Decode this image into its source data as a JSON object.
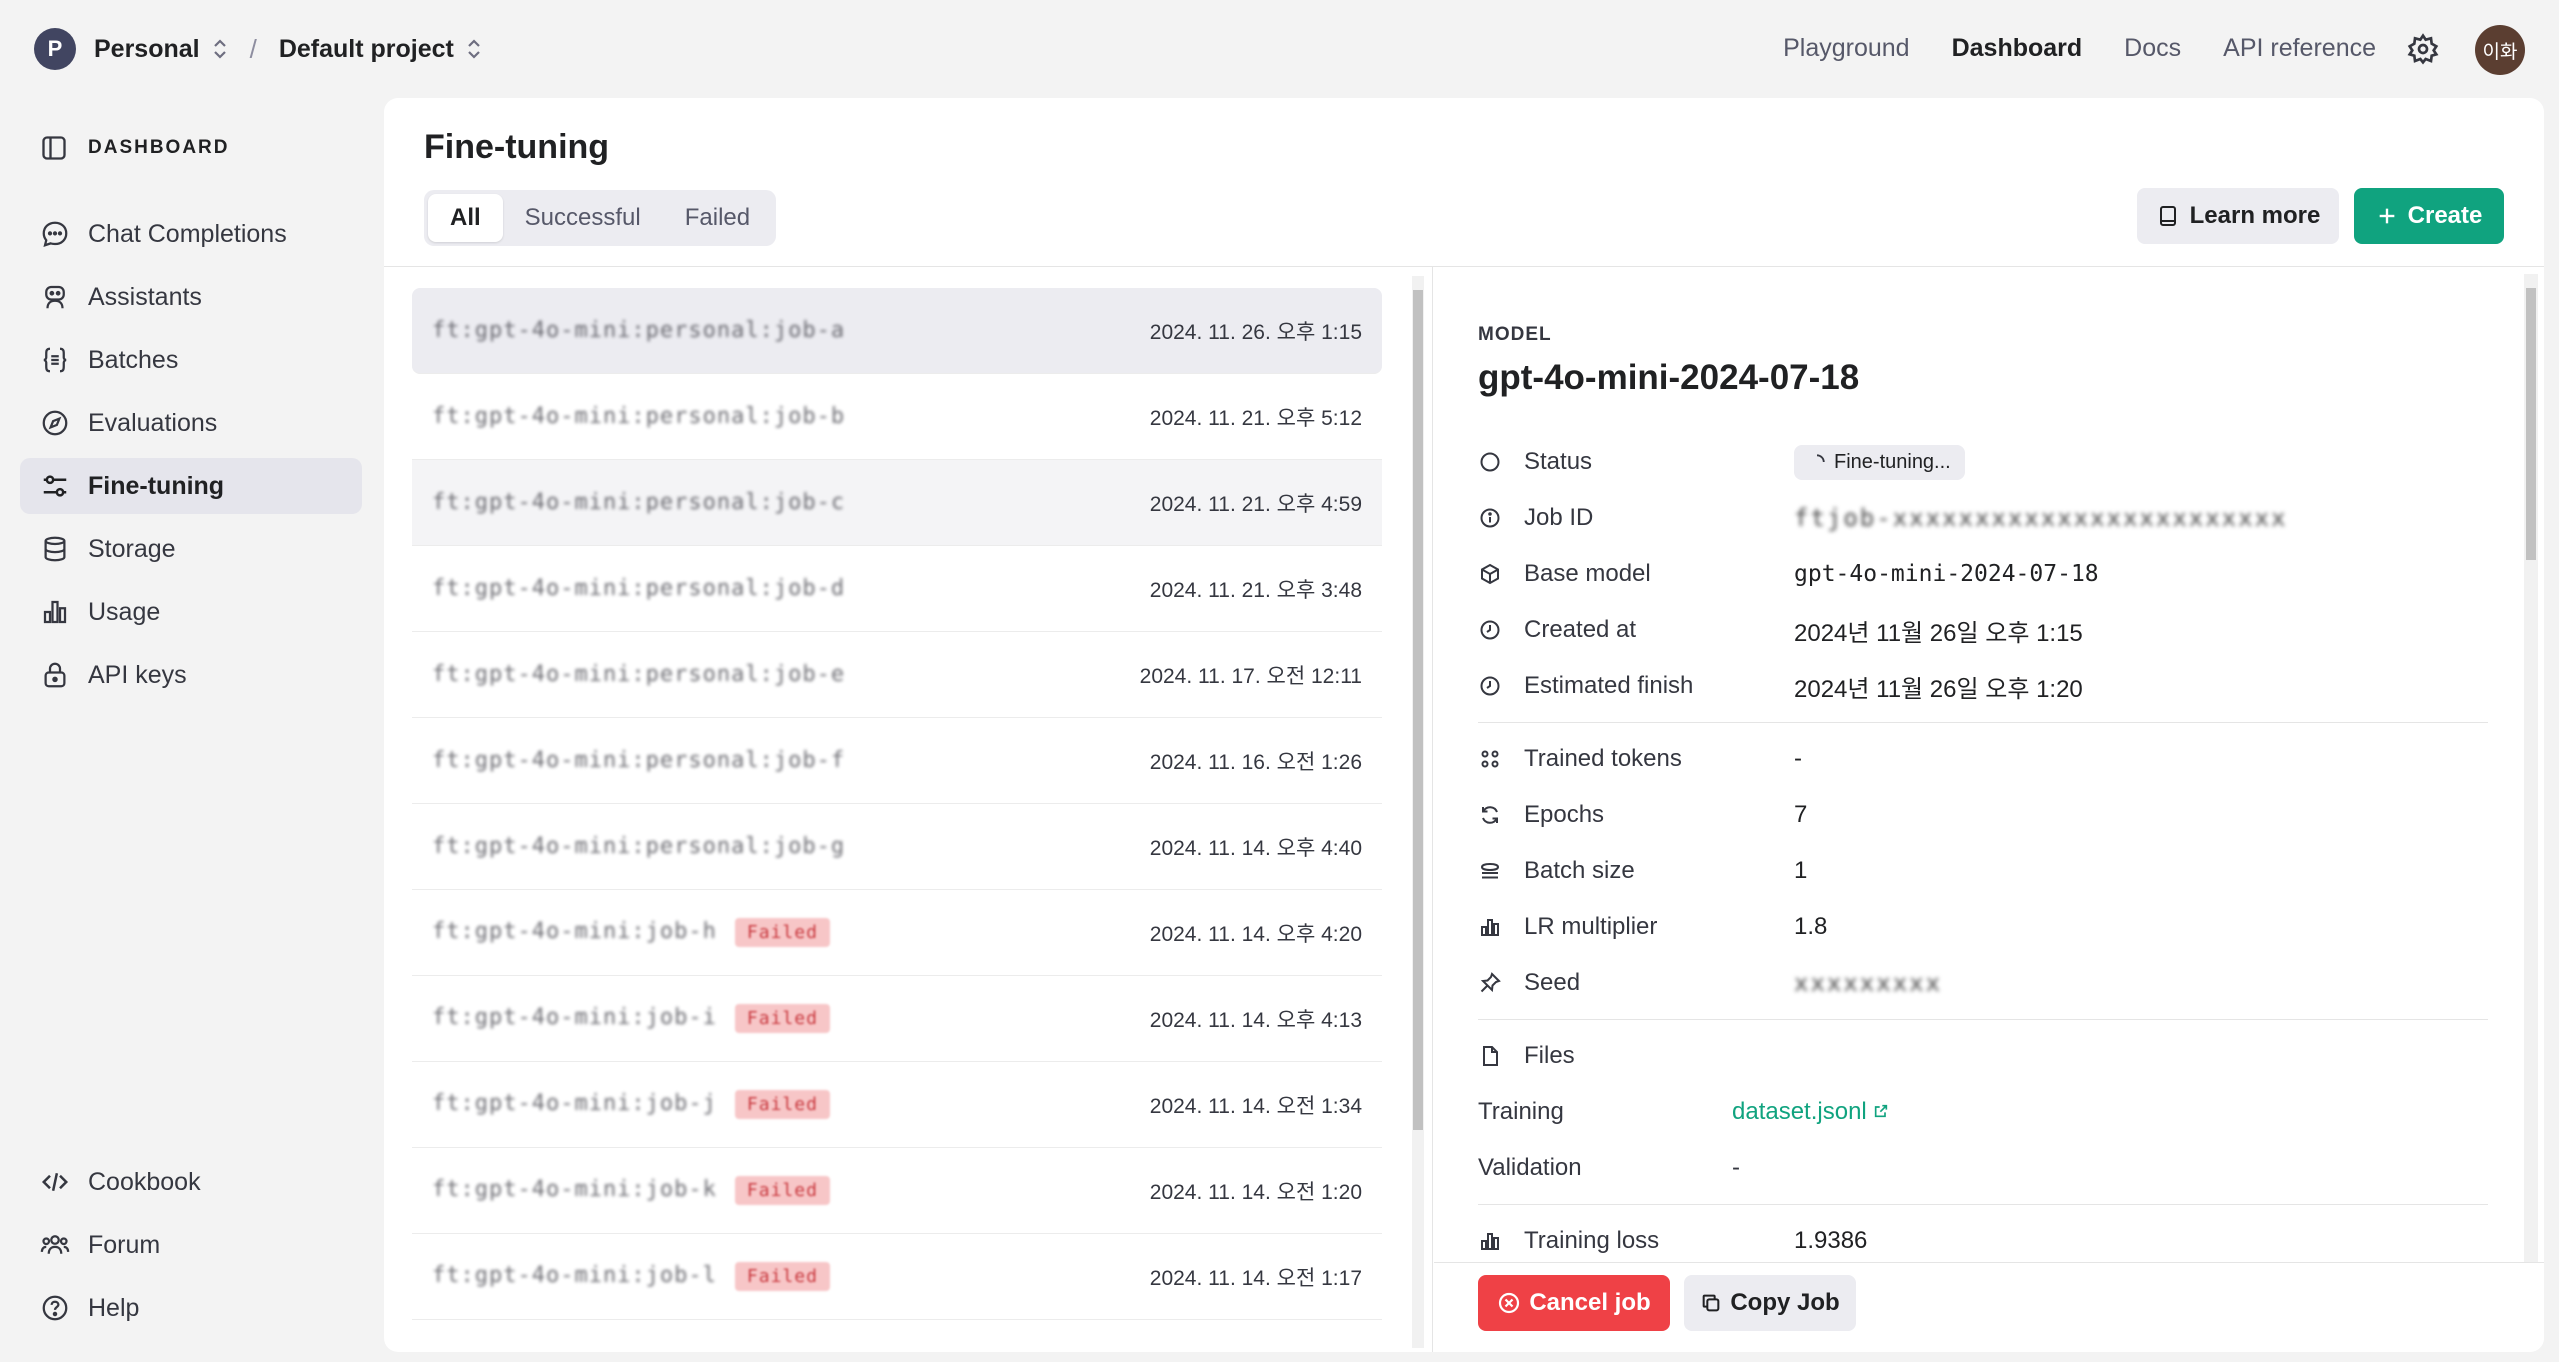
{
  "topbar": {
    "org_initial": "P",
    "org_name": "Personal",
    "separator": "/",
    "project_name": "Default project",
    "nav": [
      "Playground",
      "Dashboard",
      "Docs",
      "API reference"
    ],
    "user_initials": "이화"
  },
  "sidebar": {
    "header": "DASHBOARD",
    "items": [
      {
        "label": "Chat Completions",
        "icon": "chat-bubble-icon"
      },
      {
        "label": "Assistants",
        "icon": "robot-icon"
      },
      {
        "label": "Batches",
        "icon": "brackets-icon"
      },
      {
        "label": "Evaluations",
        "icon": "compass-icon"
      },
      {
        "label": "Fine-tuning",
        "icon": "sliders-icon",
        "active": true
      },
      {
        "label": "Storage",
        "icon": "database-icon"
      },
      {
        "label": "Usage",
        "icon": "bar-chart-icon"
      },
      {
        "label": "API keys",
        "icon": "lock-icon"
      }
    ],
    "bottom": [
      {
        "label": "Cookbook",
        "icon": "code-icon"
      },
      {
        "label": "Forum",
        "icon": "people-icon"
      },
      {
        "label": "Help",
        "icon": "help-icon"
      }
    ]
  },
  "main": {
    "title": "Fine-tuning",
    "tabs": [
      "All",
      "Successful",
      "Failed"
    ],
    "learn_more": "Learn more",
    "create": "Create",
    "jobs": [
      {
        "name": "ft:gpt-4o-mini:personal:job-a",
        "date": "2024. 11. 26. 오후 1:15",
        "tag": ""
      },
      {
        "name": "ft:gpt-4o-mini:personal:job-b",
        "date": "2024. 11. 21. 오후 5:12",
        "tag": ""
      },
      {
        "name": "ft:gpt-4o-mini:personal:job-c",
        "date": "2024. 11. 21. 오후 4:59",
        "tag": ""
      },
      {
        "name": "ft:gpt-4o-mini:personal:job-d",
        "date": "2024. 11. 21. 오후 3:48",
        "tag": ""
      },
      {
        "name": "ft:gpt-4o-mini:personal:job-e",
        "date": "2024. 11. 17. 오전 12:11",
        "tag": ""
      },
      {
        "name": "ft:gpt-4o-mini:personal:job-f",
        "date": "2024. 11. 16. 오전 1:26",
        "tag": ""
      },
      {
        "name": "ft:gpt-4o-mini:personal:job-g",
        "date": "2024. 11. 14. 오후 4:40",
        "tag": ""
      },
      {
        "name": "ft:gpt-4o-mini:job-h",
        "date": "2024. 11. 14. 오후 4:20",
        "tag": "Failed"
      },
      {
        "name": "ft:gpt-4o-mini:job-i",
        "date": "2024. 11. 14. 오후 4:13",
        "tag": "Failed"
      },
      {
        "name": "ft:gpt-4o-mini:job-j",
        "date": "2024. 11. 14. 오전 1:34",
        "tag": "Failed"
      },
      {
        "name": "ft:gpt-4o-mini:job-k",
        "date": "2024. 11. 14. 오전 1:20",
        "tag": "Failed"
      },
      {
        "name": "ft:gpt-4o-mini:job-l",
        "date": "2024. 11. 14. 오전 1:17",
        "tag": "Failed"
      }
    ]
  },
  "detail": {
    "model_label": "MODEL",
    "model_name": "gpt-4o-mini-2024-07-18",
    "status_label": "Status",
    "status_value": "Fine-tuning...",
    "job_id_label": "Job ID",
    "job_id_value": "ftjob-xxxxxxxxxxxxxxxxxxxxxxxx",
    "base_model_label": "Base model",
    "base_model_value": "gpt-4o-mini-2024-07-18",
    "created_label": "Created at",
    "created_value": "2024년 11월 26일 오후 1:15",
    "finish_label": "Estimated finish",
    "finish_value": "2024년 11월 26일 오후 1:20",
    "trained_tokens_label": "Trained tokens",
    "trained_tokens_value": "-",
    "epochs_label": "Epochs",
    "epochs_value": "7",
    "batch_label": "Batch size",
    "batch_value": "1",
    "lr_label": "LR multiplier",
    "lr_value": "1.8",
    "seed_label": "Seed",
    "seed_value": "xxxxxxxxx",
    "files_label": "Files",
    "training_label": "Training",
    "training_value": "dataset.jsonl",
    "validation_label": "Validation",
    "validation_value": "-",
    "loss_label": "Training loss",
    "loss_value": "1.9386",
    "cancel": "Cancel job",
    "copy": "Copy Job"
  },
  "colors": {
    "accent": "#10a37f",
    "danger": "#ef4146",
    "selected": "#ececf1"
  }
}
